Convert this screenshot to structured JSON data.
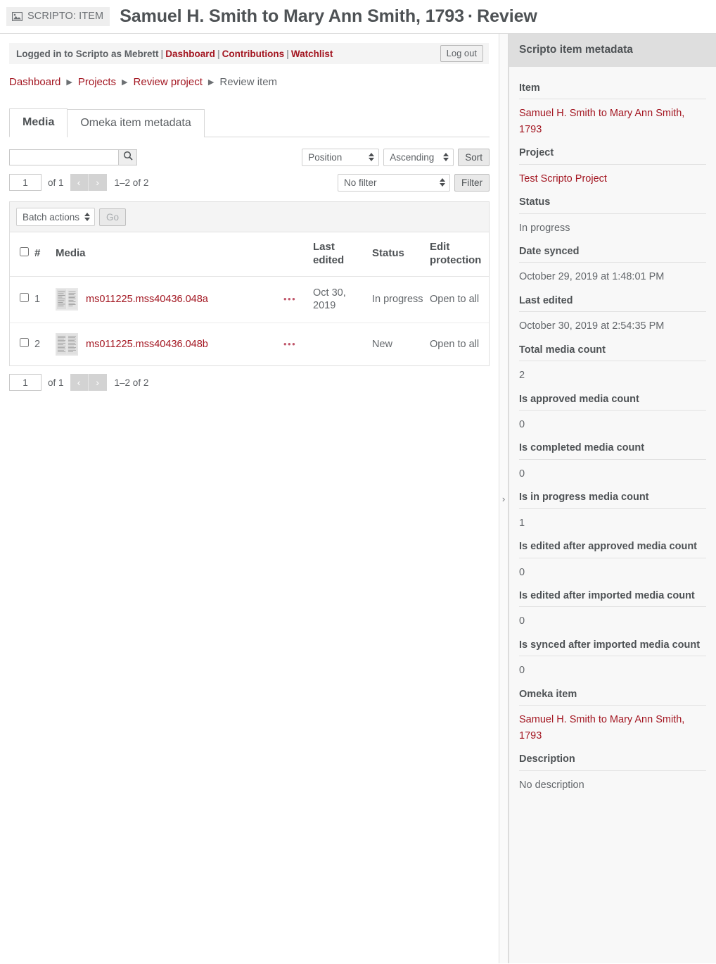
{
  "header": {
    "badge_label": "SCRIPTO: ITEM",
    "badge_icon": "image-icon",
    "title": "Samuel H. Smith to Mary Ann Smith, 1793",
    "title_separator": "·",
    "title_suffix": "Review"
  },
  "userbar": {
    "logged_in_text": "Logged in to Scripto as Mebrett",
    "links": [
      "Dashboard",
      "Contributions",
      "Watchlist"
    ],
    "logout_label": "Log out",
    "divider": "|"
  },
  "breadcrumb": {
    "items": [
      "Dashboard",
      "Projects",
      "Review project"
    ],
    "current": "Review item",
    "arrow": "▶"
  },
  "tabs": [
    {
      "label": "Media",
      "active": true
    },
    {
      "label": "Omeka item metadata",
      "active": false
    }
  ],
  "toolbar": {
    "search_value": "",
    "search_placeholder": "",
    "search_icon": "search-icon",
    "sort_by": "Position",
    "sort_dir": "Ascending",
    "sort_label": "Sort",
    "filter_value": "No filter",
    "filter_label": "Filter",
    "batch_actions": "Batch actions",
    "go_label": "Go"
  },
  "pagination_top": {
    "page": "1",
    "of": "of 1",
    "prev": "‹",
    "next": "›",
    "range": "1–2 of 2"
  },
  "pagination_bottom": {
    "page": "1",
    "of": "of 1",
    "prev": "‹",
    "next": "›",
    "range": "1–2 of 2"
  },
  "table": {
    "columns": [
      "",
      "#",
      "Media",
      "",
      "Last edited",
      "Status",
      "Edit protection"
    ],
    "rows": [
      {
        "num": "1",
        "media": "ms011225.mss40436.048a",
        "dots": "•••",
        "last_edited": "Oct 30, 2019",
        "status": "In progress",
        "edit_protection": "Open to all"
      },
      {
        "num": "2",
        "media": "ms011225.mss40436.048b",
        "dots": "•••",
        "last_edited": "",
        "status": "New",
        "edit_protection": "Open to all"
      }
    ]
  },
  "sidebar": {
    "heading": "Scripto item metadata",
    "collapse_icon": "chevron-right-icon",
    "fields": [
      {
        "label": "Item",
        "value": "Samuel H. Smith to Mary Ann Smith, 1793",
        "link": true
      },
      {
        "label": "Project",
        "value": "Test Scripto Project",
        "link": true
      },
      {
        "label": "Status",
        "value": "In progress",
        "link": false
      },
      {
        "label": "Date synced",
        "value": "October 29, 2019 at 1:48:01 PM",
        "link": false
      },
      {
        "label": "Last edited",
        "value": "October 30, 2019 at 2:54:35 PM",
        "link": false
      },
      {
        "label": "Total media count",
        "value": "2",
        "link": false
      },
      {
        "label": "Is approved media count",
        "value": "0",
        "link": false
      },
      {
        "label": "Is completed media count",
        "value": "0",
        "link": false
      },
      {
        "label": "Is in progress media count",
        "value": "1",
        "link": false
      },
      {
        "label": "Is edited after approved media count",
        "value": "0",
        "link": false
      },
      {
        "label": "Is edited after imported media count",
        "value": "0",
        "link": false
      },
      {
        "label": "Is synced after imported media count",
        "value": "0",
        "link": false
      },
      {
        "label": "Omeka item",
        "value": "Samuel H. Smith to Mary Ann Smith, 1793",
        "link": true
      },
      {
        "label": "Description",
        "value": "No description",
        "link": false
      }
    ]
  },
  "colors": {
    "link": "#a31621",
    "text": "#63676b",
    "heading": "#4e5255",
    "sidebar_head_bg": "#dedede",
    "sidebar_bg": "#f8f8f8",
    "bar_bg": "#f4f4f4",
    "dots": "#c0566a"
  }
}
